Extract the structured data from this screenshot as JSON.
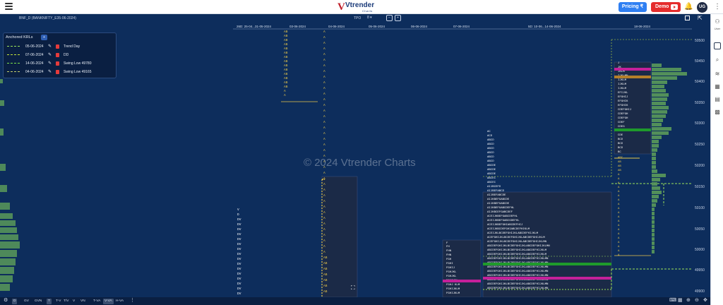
{
  "header": {
    "logo": {
      "brand": "Vtrender",
      "sub": "Charts"
    },
    "pricing_label": "Pricing ₹",
    "demo_label": "Demo",
    "avatar": "UG"
  },
  "toolbar": {
    "symbol": "BNF_D (BANKNIFTY_E35-06-2024)",
    "tpo_label": "TPO",
    "tpo_value": "8",
    "tpo_minus": "−",
    "tpo_plus": "+"
  },
  "rail": {
    "user_label": "User"
  },
  "date_headers": [
    "26D: 25-04...31-05-2024",
    "03-06-2024",
    "04-06-2024",
    "05-06-2024",
    "06-06-2024",
    "07-06-2024",
    "5D: 10-06...14-06-2024",
    "18-06-2024"
  ],
  "price_labels": [
    "50500",
    "50450",
    "50400",
    "50350",
    "50300",
    "50250",
    "50200",
    "50150",
    "50100",
    "50050",
    "50000",
    "49950",
    "49900"
  ],
  "watermark": "© 2024 Vtrender Charts",
  "krl_panel": {
    "title": "Anchored KRLs",
    "add_label": "+",
    "rows": [
      {
        "date": "05-06-2024",
        "name": "Trend Day",
        "color": "#9be35a"
      },
      {
        "date": "07-06-2024",
        "name": "DD",
        "color": "#c6e63a"
      },
      {
        "date": "14-06-2024",
        "name": "Swing Low 49780",
        "color": "#7ae04a"
      },
      {
        "date": "04-06-2024",
        "name": "Swing Low 49165",
        "color": "#c7d06a"
      }
    ]
  },
  "bottom": {
    "buttons": [
      "D",
      "GV",
      "GVN",
      "T",
      "T-V",
      "T/V",
      "V",
      "VN",
      "T-VA",
      "V-VA",
      "H-VA"
    ]
  },
  "colors": {
    "bg": "#0d2d5c",
    "profile_green": "#5a9a5a",
    "tpo_yellow": "#e8c64a",
    "poc_magenta": "#c4209a",
    "va_green": "#1f9a2b"
  }
}
